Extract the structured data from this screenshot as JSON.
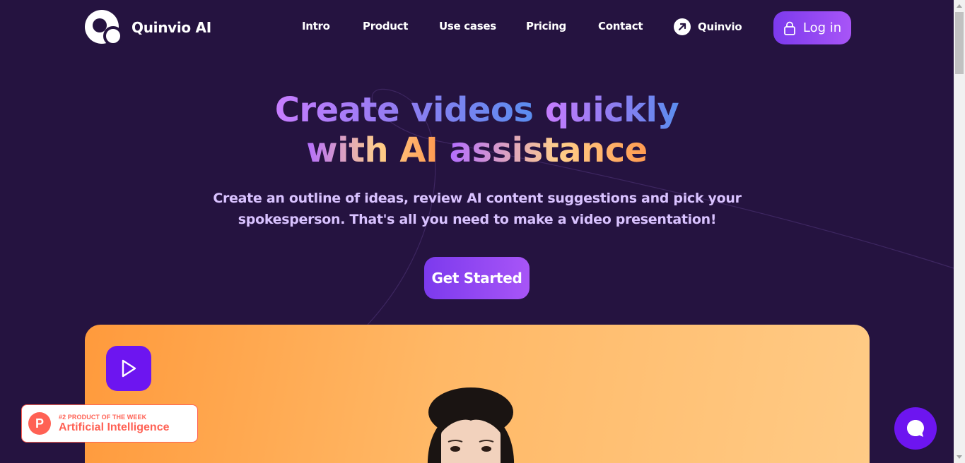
{
  "brand": {
    "name": "Quinvio AI"
  },
  "nav": {
    "items": [
      {
        "label": "Intro"
      },
      {
        "label": "Product"
      },
      {
        "label": "Use cases"
      },
      {
        "label": "Pricing"
      },
      {
        "label": "Contact"
      }
    ],
    "external_label": "Quinvio",
    "login_label": "Log in"
  },
  "hero": {
    "title_line1_a": "Create videos",
    "title_line1_b": "quickly",
    "title_line2_a": "with AI",
    "title_line2_b": "assistance",
    "subtitle": "Create an outline of ideas, review AI content suggestions and pick your spokesperson. That's all you need to make a video presentation!",
    "cta_label": "Get Started"
  },
  "badge": {
    "rank_text": "#2 PRODUCT OF THE WEEK",
    "category": "Artificial Intelligence",
    "logo_letter": "P"
  },
  "icons": {
    "external": "arrow-up-right-icon",
    "lock": "lock-icon",
    "play": "play-icon",
    "chat": "chat-icon"
  },
  "colors": {
    "background": "#251340",
    "accent": "#7c3aed",
    "accent_light": "#a855f7",
    "video_card": "#ffb866",
    "badge": "#ff6154"
  }
}
